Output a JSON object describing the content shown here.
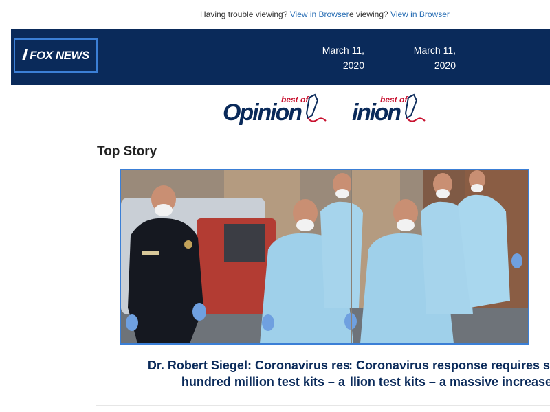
{
  "notice": {
    "text": "Having trouble viewing?",
    "link": "View in Browser",
    "fragment_tail": "e viewing?"
  },
  "header": {
    "logo_text": "FOX NEWS",
    "date": "March 11, 2020",
    "date_line1": "March 11,",
    "date_line2": "2020"
  },
  "banner": {
    "best_of": "best of",
    "opinion": "Opinion",
    "opinion_fragment": "inion"
  },
  "section": {
    "title": "Top Story"
  },
  "story": {
    "headline_line1": "Dr. Robert Siegel: Coronavirus response requires several",
    "headline_line2": "hundred million test kits – a massive increase",
    "image_description_icon": "photo-icon"
  },
  "colors": {
    "header_bg": "#0a2a5a",
    "accent": "#3b7fd6",
    "link": "#2a6fb5",
    "brand_red": "#c8102e",
    "headline": "#0a2a5a"
  }
}
